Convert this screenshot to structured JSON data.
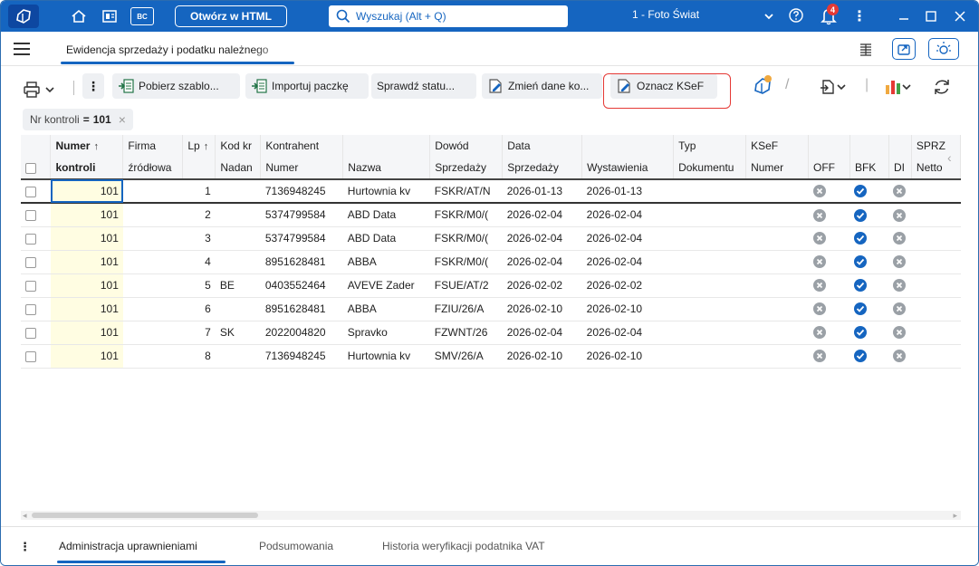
{
  "titlebar": {
    "html_button": "Otwórz w HTML",
    "bc_label": "BC",
    "search_placeholder": "Wyszukaj (Alt + Q)",
    "company": "1 - Foto Świat",
    "notifications": "4"
  },
  "tabstrip": {
    "active_tab": "Ewidencja sprzedaży i podatku należnego"
  },
  "toolbar": {
    "pobierz": "Pobierz szablo...",
    "importuj": "Importuj paczkę",
    "sprawdz": "Sprawdź statu...",
    "zmien": "Zmień dane ko...",
    "oznacz": "Oznacz KSeF"
  },
  "filter": {
    "label": "Nr kontroli",
    "op": "=",
    "value": "101",
    "clear": "×"
  },
  "grid": {
    "header1": {
      "numer": "Numer",
      "firma": "Firma",
      "lp": "Lp",
      "kod": "Kod kr",
      "kontrahent": "Kontrahent",
      "dowod": "Dowód",
      "data": "Data",
      "typ": "Typ",
      "ksef": "KSeF",
      "sprz": "SPRZ"
    },
    "header2": {
      "kontroli": "kontroli",
      "zrodlowa": "źródłowa",
      "nadan": "Nadan",
      "numer": "Numer",
      "nazwa": "Nazwa",
      "sprzedazy": "Sprzedaży",
      "data_sprzedazy": "Sprzedaży",
      "wystawienia": "Wystawienia",
      "dokumentu": "Dokumentu",
      "ksef_numer": "Numer",
      "off": "OFF",
      "bfk": "BFK",
      "di": "DI",
      "netto": "Netto"
    },
    "rows": [
      {
        "nr": "101",
        "lp": "1",
        "kod": "",
        "numer": "7136948245",
        "nazwa": "Hurtownia kv",
        "dowod": "FSKR/AT/N",
        "data_sprz": "2026-01-13",
        "data_wyst": "2026-01-13"
      },
      {
        "nr": "101",
        "lp": "2",
        "kod": "",
        "numer": "5374799584",
        "nazwa": "ABD Data",
        "dowod": "FSKR/M0/(",
        "data_sprz": "2026-02-04",
        "data_wyst": "2026-02-04"
      },
      {
        "nr": "101",
        "lp": "3",
        "kod": "",
        "numer": "5374799584",
        "nazwa": "ABD Data",
        "dowod": "FSKR/M0/(",
        "data_sprz": "2026-02-04",
        "data_wyst": "2026-02-04"
      },
      {
        "nr": "101",
        "lp": "4",
        "kod": "",
        "numer": "8951628481",
        "nazwa": "ABBA",
        "dowod": "FSKR/M0/(",
        "data_sprz": "2026-02-04",
        "data_wyst": "2026-02-04"
      },
      {
        "nr": "101",
        "lp": "5",
        "kod": "BE",
        "numer": "0403552464",
        "nazwa": "AVEVE Zader",
        "dowod": "FSUE/AT/2",
        "data_sprz": "2026-02-02",
        "data_wyst": "2026-02-02"
      },
      {
        "nr": "101",
        "lp": "6",
        "kod": "",
        "numer": "8951628481",
        "nazwa": "ABBA",
        "dowod": "FZIU/26/A",
        "data_sprz": "2026-02-10",
        "data_wyst": "2026-02-10"
      },
      {
        "nr": "101",
        "lp": "7",
        "kod": "SK",
        "numer": "2022004820",
        "nazwa": "Spravko",
        "dowod": "FZWNT/26",
        "data_sprz": "2026-02-04",
        "data_wyst": "2026-02-04"
      },
      {
        "nr": "101",
        "lp": "8",
        "kod": "",
        "numer": "7136948245",
        "nazwa": "Hurtownia kv",
        "dowod": "SMV/26/A",
        "data_sprz": "2026-02-10",
        "data_wyst": "2026-02-10"
      }
    ]
  },
  "bottom_tabs": {
    "tab1": "Administracja uprawnieniami",
    "tab2": "Podsumowania",
    "tab3": "Historia weryfikacji podatnika VAT"
  },
  "colors": {
    "brand": "#1565c0",
    "highlight": "#e53935",
    "key_column": "#fffde2"
  }
}
